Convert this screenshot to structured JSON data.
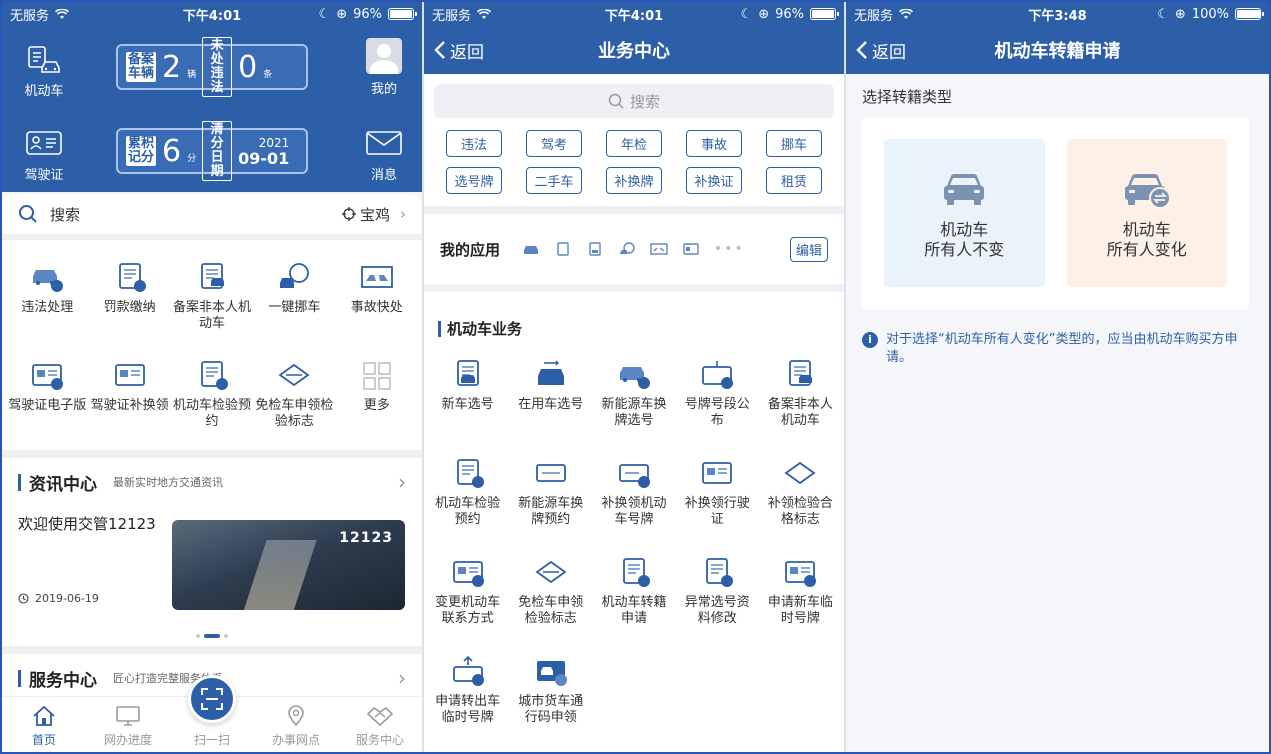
{
  "colors": {
    "primary": "#2d5fa8",
    "bg": "#f3f4f6",
    "opt_a": "#eaf2fb",
    "opt_b": "#fdf0e6"
  },
  "panel1": {
    "status": {
      "carrier": "无服务",
      "time": "下午4:01",
      "battery": "96%"
    },
    "header": {
      "vehicle_label": "机动车",
      "license_label": "驾驶证",
      "me_label": "我的",
      "msg_label": "消息",
      "plate1": {
        "label_a": "备案车辆",
        "count": "2",
        "unit": "辆",
        "label_b": "未处违法",
        "count_b": "0",
        "unit_b": "条"
      },
      "plate2": {
        "label_a": "累积记分",
        "count": "6",
        "unit": "分",
        "label_b": "清分日期",
        "year": "2021",
        "date": "09-01"
      }
    },
    "search": {
      "placeholder": "搜索",
      "city": "宝鸡"
    },
    "grid": [
      {
        "label": "违法处理",
        "icon": "car-violation-icon"
      },
      {
        "label": "罚款缴纳",
        "icon": "fine-payment-icon"
      },
      {
        "label": "备案非本人机动车",
        "icon": "record-vehicle-icon"
      },
      {
        "label": "一键挪车",
        "icon": "move-car-icon"
      },
      {
        "label": "事故快处",
        "icon": "accident-icon"
      },
      {
        "label": "驾驶证电子版",
        "icon": "e-license-icon"
      },
      {
        "label": "驾驶证补换领",
        "icon": "license-replace-icon"
      },
      {
        "label": "机动车检验预约",
        "icon": "inspection-icon"
      },
      {
        "label": "免检车申领检验标志",
        "icon": "exempt-icon"
      },
      {
        "label": "更多",
        "icon": "more-grid-icon"
      }
    ],
    "news": {
      "title": "资讯中心",
      "subtitle": "最新实时地方交通资讯",
      "headline": "欢迎使用交管12123",
      "date": "2019-06-19",
      "image_text": "12123"
    },
    "service": {
      "title": "服务中心",
      "subtitle": "匠心打造完整服务体系"
    },
    "tabs": [
      {
        "label": "首页",
        "icon": "home-icon"
      },
      {
        "label": "网办进度",
        "icon": "monitor-icon"
      },
      {
        "label": "扫一扫",
        "icon": "scan-icon"
      },
      {
        "label": "办事网点",
        "icon": "location-icon"
      },
      {
        "label": "服务中心",
        "icon": "handshake-icon"
      }
    ]
  },
  "panel2": {
    "status": {
      "carrier": "无服务",
      "time": "下午4:01",
      "battery": "96%"
    },
    "nav": {
      "back": "返回",
      "title": "业务中心"
    },
    "search": {
      "placeholder": "搜索"
    },
    "tags": [
      "违法",
      "驾考",
      "年检",
      "事故",
      "挪车",
      "选号牌",
      "二手车",
      "补换牌",
      "补换证",
      "租赁"
    ],
    "myapp": {
      "title": "我的应用",
      "edit": "编辑"
    },
    "section": "机动车业务",
    "grid": [
      {
        "label": "新车选号",
        "icon": "new-car-plate-icon"
      },
      {
        "label": "在用车选号",
        "icon": "used-car-plate-icon"
      },
      {
        "label": "新能源车换牌选号",
        "icon": "ev-plate-icon"
      },
      {
        "label": "号牌号段公布",
        "icon": "plate-range-icon"
      },
      {
        "label": "备案非本人机动车",
        "icon": "record-vehicle-icon"
      },
      {
        "label": "机动车检验预约",
        "icon": "inspection-icon"
      },
      {
        "label": "新能源车换牌预约",
        "icon": "ev-appointment-icon"
      },
      {
        "label": "补换领机动车号牌",
        "icon": "plate-replace-icon"
      },
      {
        "label": "补换领行驶证",
        "icon": "license-replace-icon"
      },
      {
        "label": "补领检验合格标志",
        "icon": "inspection-mark-icon"
      },
      {
        "label": "变更机动车联系方式",
        "icon": "contact-change-icon"
      },
      {
        "label": "免检车申领检验标志",
        "icon": "exempt-icon"
      },
      {
        "label": "机动车转籍申请",
        "icon": "transfer-icon"
      },
      {
        "label": "异常选号资料修改",
        "icon": "abnormal-plate-icon"
      },
      {
        "label": "申请新车临时号牌",
        "icon": "temp-plate-icon"
      },
      {
        "label": "申请转出车临时号牌",
        "icon": "transfer-out-icon"
      },
      {
        "label": "城市货车通行码申领",
        "icon": "truck-pass-icon"
      }
    ]
  },
  "panel3": {
    "status": {
      "carrier": "无服务",
      "time": "下午3:48",
      "battery": "100%"
    },
    "nav": {
      "back": "返回",
      "title": "机动车转籍申请"
    },
    "subtitle": "选择转籍类型",
    "options": [
      {
        "line1": "机动车",
        "line2": "所有人不变",
        "icon": "car-icon"
      },
      {
        "line1": "机动车",
        "line2": "所有人变化",
        "icon": "car-transfer-icon"
      }
    ],
    "note": "对于选择“机动车所有人变化”类型的，应当由机动车购买方申请。"
  }
}
